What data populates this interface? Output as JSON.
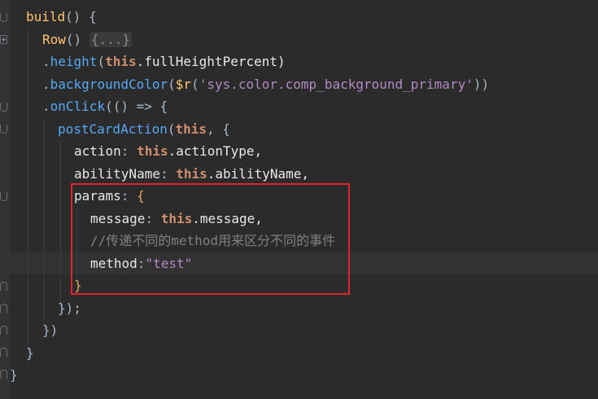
{
  "code": {
    "l1_build": "build",
    "l1_parens": "() {",
    "l2_row": "Row",
    "l2_parens": "() ",
    "l2_folded": "{...}",
    "l3_dot": ".",
    "l3_height": "height",
    "l3_open": "(",
    "l3_this": "this",
    "l3_rest": ".fullHeightPercent)",
    "l4_dot": ".",
    "l4_bg": "backgroundColor",
    "l4_open": "(",
    "l4_r": "$r",
    "l4_open2": "(",
    "l4_str": "'sys.color.comp_background_primary'",
    "l4_close": "))",
    "l5_dot": ".",
    "l5_onclick": "onClick",
    "l5_rest": "(() => {",
    "l6_fn": "postCardAction",
    "l6_open": "(",
    "l6_this": "this",
    "l6_rest": ", {",
    "l7_key": "action",
    "l7_colon": ": ",
    "l7_this": "this",
    "l7_rest": ".actionType,",
    "l8_key": "abilityName",
    "l8_colon": ": ",
    "l8_this": "this",
    "l8_rest": ".abilityName,",
    "l9_key": "params",
    "l9_colon": ": ",
    "l9_brace": "{",
    "l10_key": "message",
    "l10_colon": ": ",
    "l10_this": "this",
    "l10_rest": ".message,",
    "l11_comment": "//传递不同的method用来区分不同的事件",
    "l12_key": "method",
    "l12_colon": ":",
    "l12_str": "\"test\"",
    "l13_brace": "}",
    "l14_close": "});",
    "l15_close": "})",
    "l16_close": "}",
    "l17_close": "}"
  },
  "colors": {
    "background": "#2b2b2b",
    "highlight_box": "#e0242b"
  }
}
